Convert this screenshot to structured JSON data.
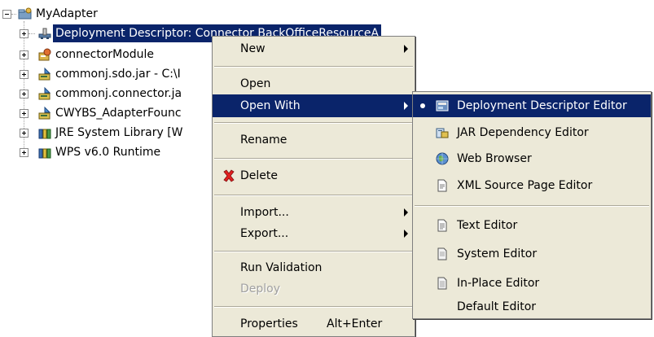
{
  "tree": {
    "root_label": "MyAdapter",
    "items": [
      {
        "label": "Deployment Descriptor: Connector BackOfficeResourceA",
        "icon": "deployment-descriptor-icon"
      },
      {
        "label": "connectorModule",
        "icon": "connector-module-icon"
      },
      {
        "label": "commonj.sdo.jar - C:\\I",
        "icon": "jar-icon"
      },
      {
        "label": "commonj.connector.ja",
        "icon": "jar-icon"
      },
      {
        "label": "CWYBS_AdapterFounc",
        "icon": "jar-icon"
      },
      {
        "label": "JRE System Library [W",
        "icon": "library-icon"
      },
      {
        "label": "WPS v6.0 Runtime",
        "icon": "library-icon"
      }
    ]
  },
  "context_menu": {
    "new": "New",
    "open": "Open",
    "open_with": "Open With",
    "rename": "Rename",
    "delete": "Delete",
    "import": "Import...",
    "export": "Export...",
    "run_validation": "Run Validation",
    "deploy": "Deploy",
    "properties": "Properties",
    "properties_accel": "Alt+Enter"
  },
  "open_with_menu": {
    "items": [
      {
        "label": "Deployment Descriptor Editor",
        "icon": "deployment-editor-icon"
      },
      {
        "label": "JAR Dependency Editor",
        "icon": "jar-dependency-icon"
      },
      {
        "label": "Web Browser",
        "icon": "globe-icon"
      },
      {
        "label": "XML Source Page Editor",
        "icon": "xml-file-icon"
      },
      {
        "label": "Text Editor",
        "icon": "text-file-icon"
      },
      {
        "label": "System Editor",
        "icon": "system-file-icon"
      },
      {
        "label": "In-Place Editor",
        "icon": "inplace-file-icon"
      },
      {
        "label": "Default Editor",
        "icon": ""
      }
    ]
  },
  "colors": {
    "selection": "#0a246a",
    "menu_bg": "#ece9d8"
  }
}
